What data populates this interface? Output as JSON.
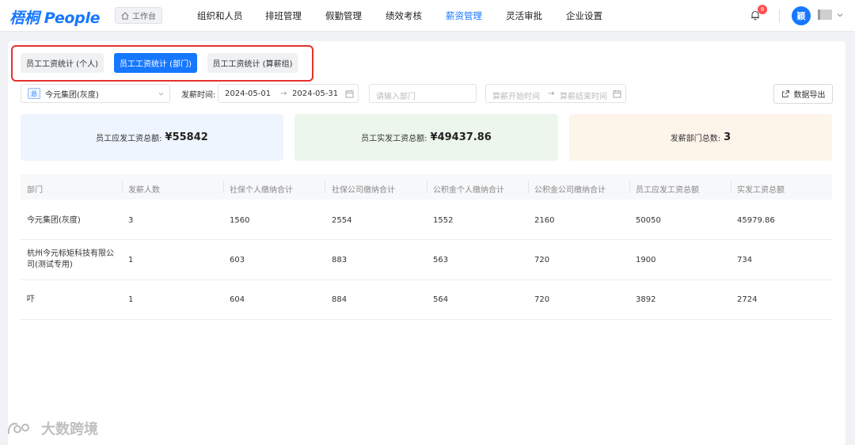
{
  "header": {
    "logo": "梧桐 People",
    "workbench": "工作台",
    "nav": [
      "组织和人员",
      "排班管理",
      "假勤管理",
      "绩效考核",
      "薪资管理",
      "灵活审批",
      "企业设置"
    ],
    "active_nav": "薪资管理",
    "badge": "8",
    "avatar": "颖"
  },
  "tabs": [
    {
      "label": "员工工资统计 (个人)",
      "active": false
    },
    {
      "label": "员工工资统计 (部门)",
      "active": true
    },
    {
      "label": "员工工资统计 (算薪组)",
      "active": false
    }
  ],
  "filters": {
    "company_tag": "总",
    "company": "今元集团(灰度)",
    "time_label": "发薪时间:",
    "date_start": "2024-05-01",
    "date_end": "2024-05-31",
    "dept_placeholder": "请输入部门",
    "calc_start_placeholder": "算薪开始时间",
    "calc_end_placeholder": "算薪结束时间",
    "export_label": "数据导出"
  },
  "stats": [
    {
      "label": "员工应发工资总额:",
      "value": "¥55842",
      "bg": "#eef5fe"
    },
    {
      "label": "员工实发工资总额:",
      "value": "¥49437.86",
      "bg": "#ecf6ec"
    },
    {
      "label": "发薪部门总数:",
      "value": "3",
      "bg": "#fdf4ea"
    }
  ],
  "table": {
    "columns": [
      "部门",
      "发薪人数",
      "社保个人缴纳合计",
      "社保公司缴纳合计",
      "公积金个人缴纳合计",
      "公积金公司缴纳合计",
      "员工应发工资总额",
      "实发工资总额"
    ],
    "rows": [
      [
        "今元集团(灰度)",
        "3",
        "1560",
        "2554",
        "1552",
        "2160",
        "50050",
        "45979.86"
      ],
      [
        "杭州今元标矩科技有限公司(测试专用)",
        "1",
        "603",
        "883",
        "563",
        "720",
        "1900",
        "734"
      ],
      [
        "吓",
        "1",
        "604",
        "884",
        "564",
        "720",
        "3892",
        "2724"
      ]
    ]
  },
  "watermark": "大数跨境"
}
